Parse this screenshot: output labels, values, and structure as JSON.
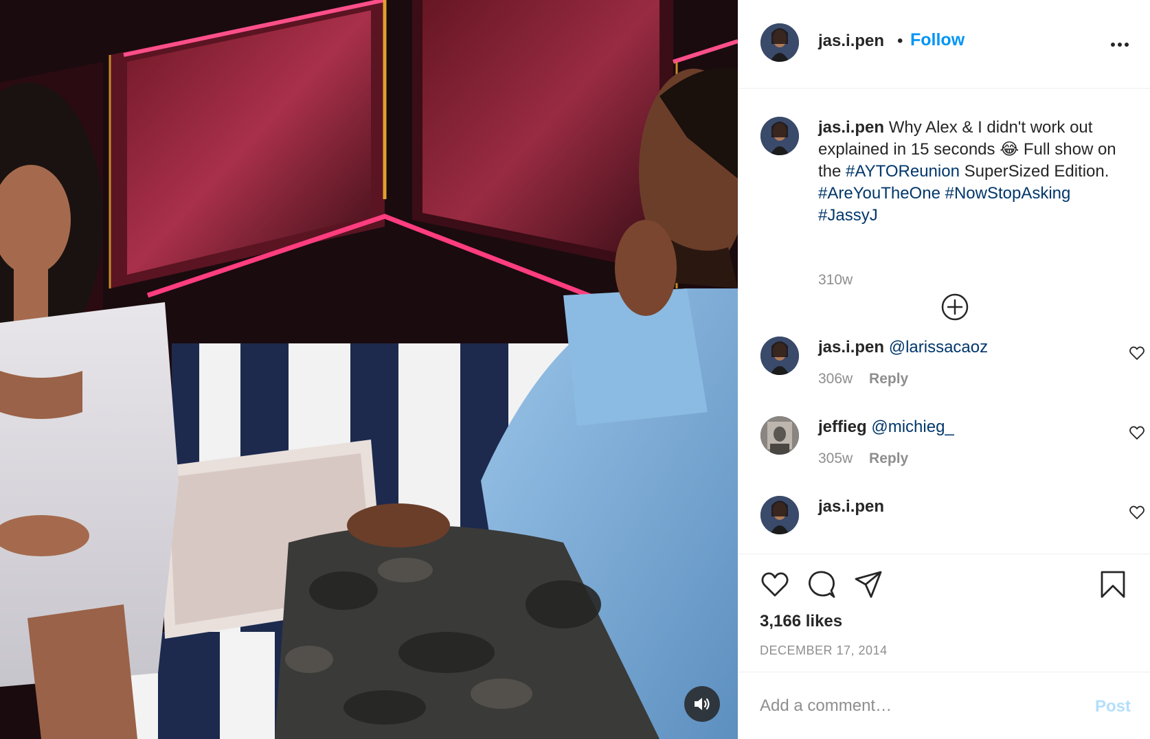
{
  "post": {
    "username": "jas.i.pen",
    "separator": "•",
    "follow_label": "Follow",
    "more_icon": "more-horizontal-icon"
  },
  "caption": {
    "username": "jas.i.pen",
    "text_1": "Why Alex & I didn't work out explained in 15 seconds",
    "emoji": "😂",
    "text_2": "Full show on the",
    "tag_1": "#AYTOReunion",
    "text_3": "SuperSized Edition.",
    "tag_2": "#AreYouTheOne",
    "tag_3": "#NowStopAsking",
    "tag_4": "#JassyJ",
    "time": "310w"
  },
  "comments": [
    {
      "username": "jas.i.pen",
      "mention": "@larissacaoz",
      "time": "306w",
      "reply_label": "Reply"
    },
    {
      "username": "jeffieg",
      "mention": "@michieg_",
      "time": "305w",
      "reply_label": "Reply"
    },
    {
      "username": "jas.i.pen",
      "mention": "",
      "time": "",
      "reply_label": ""
    }
  ],
  "actions": {
    "likes": "3,166 likes",
    "date": "DECEMBER 17, 2014"
  },
  "add_comment": {
    "placeholder": "Add a comment…",
    "post_label": "Post"
  },
  "colors": {
    "accent": "#0095f6",
    "hashtag": "#00376b",
    "muted": "#8e8e8e",
    "post_disabled": "#b2dffc"
  }
}
